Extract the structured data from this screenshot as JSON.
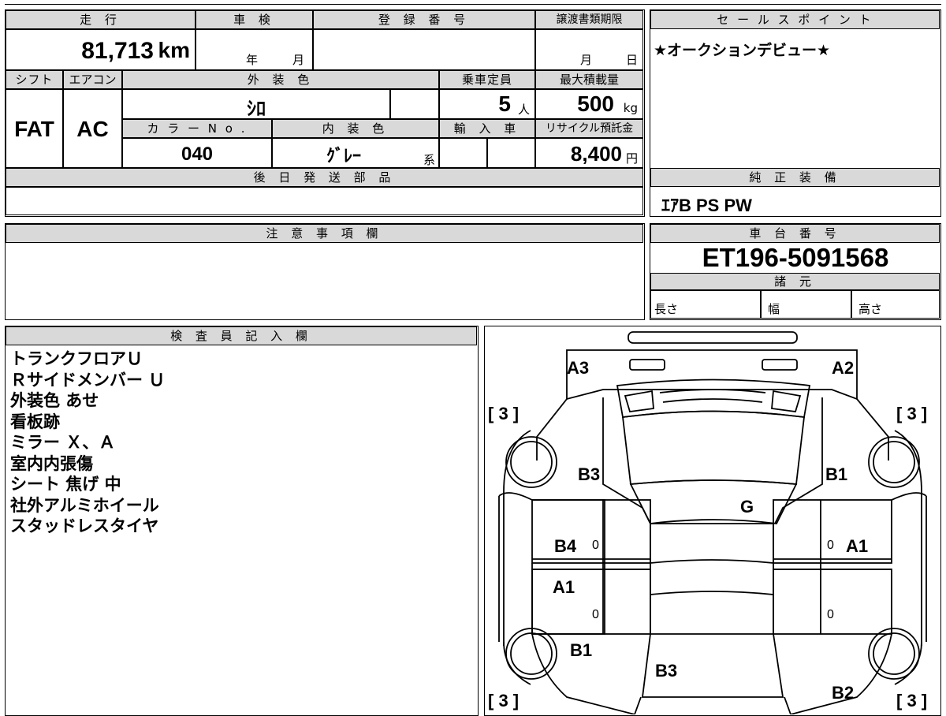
{
  "header": {
    "mileage_label": "走 行",
    "inspection_label": "車 検",
    "registration_label": "登 録 番 号",
    "transfer_label": "譲渡書類期限",
    "sales_label": "セ ー ル ス ポ イ ン ト"
  },
  "mileage": {
    "value": "81,713",
    "unit": "km"
  },
  "inspection": {
    "year": "年",
    "month": "月"
  },
  "transfer": {
    "month": "月",
    "day": "日"
  },
  "sales_point": "★オークションデビュー★",
  "row2_labels": {
    "shift": "シフト",
    "aircon": "エアコン",
    "exterior": "外 装 色",
    "capacity": "乗車定員",
    "load": "最大積載量"
  },
  "shift": "FAT",
  "aircon": "AC",
  "exterior_color": "ｼﾛ",
  "capacity": {
    "value": "5",
    "unit": "人"
  },
  "load": {
    "value": "500",
    "unit": "kg"
  },
  "row3_labels": {
    "color_no": "カ ラ ー N o .",
    "interior": "内 装 色",
    "import": "輸 入 車",
    "recycle": "リサイクル預託金"
  },
  "color_no": "040",
  "interior": {
    "value": "ｸﾞﾚｰ",
    "suffix": "系"
  },
  "recycle": {
    "value": "8,400",
    "unit": "円"
  },
  "later_parts_label": "後 日 発 送 部 品",
  "genuine_label": "純 正 装 備",
  "genuine_equipment": "ｴｱB PS PW",
  "notes_label": "注 意 事 項 欄",
  "chassis_label": "車 台 番 号",
  "chassis_number": "ET196-5091568",
  "specs_label": "諸 元",
  "specs": {
    "length": "長さ",
    "width": "幅",
    "height": "高さ"
  },
  "inspector_label": "検 査 員 記 入 欄",
  "inspector_notes": [
    "トランクフロアＵ",
    "Ｒサイドメンバー Ｕ",
    "外装色 あせ",
    "看板跡",
    "ミラー Ｘ、Ａ",
    "室内内張傷",
    "シート 焦げ 中",
    "社外アルミホイール",
    "スタッドレスタイヤ"
  ],
  "diagram": {
    "rear_left": "A3",
    "rear_right": "A2",
    "tire_rl": "[ 3 ]",
    "tire_rr": "[ 3 ]",
    "tire_fl": "[ 3 ]",
    "tire_fr": "[ 3 ]",
    "quarter_left": "B3",
    "quarter_right": "B1",
    "glass": "G",
    "rear_door_left": "B4",
    "rear_door_right": "A1",
    "front_door_left": "A1",
    "fender_left": "B1",
    "hood": "B3",
    "fender_right": "B2",
    "handle_marks": [
      "0",
      "0",
      "0",
      "0"
    ]
  }
}
